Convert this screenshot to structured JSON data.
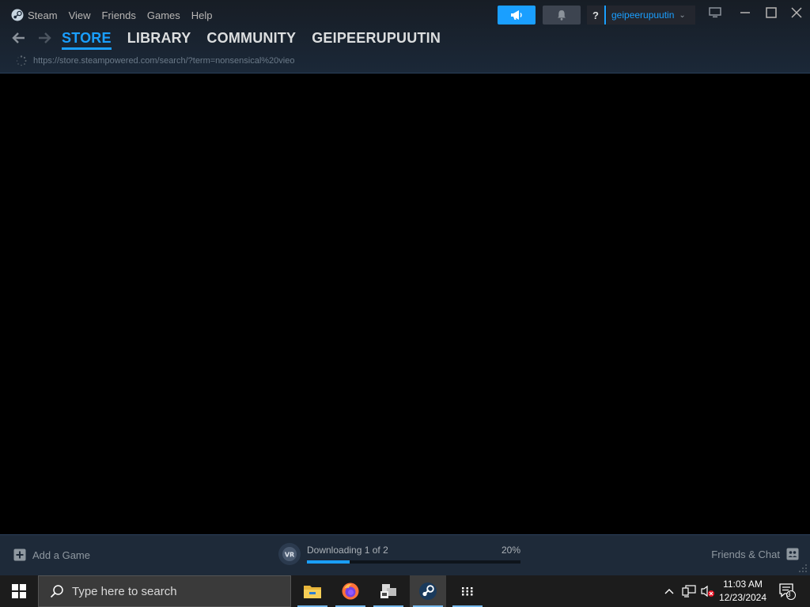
{
  "menu": {
    "items": [
      "Steam",
      "View",
      "Friends",
      "Games",
      "Help"
    ]
  },
  "nav": {
    "tabs": [
      "STORE",
      "LIBRARY",
      "COMMUNITY",
      "GEIPEERUPUUTIN"
    ],
    "active_tab": "STORE",
    "url": "https://store.steampowered.com/search/?term=nonsensical%20vieo"
  },
  "header": {
    "help_label": "?",
    "account_name": "geipeerupuutin",
    "accent_color": "#1a9fff"
  },
  "footer": {
    "add_game_label": "Add a Game",
    "download_status": "Downloading 1 of 2",
    "download_percent_label": "20%",
    "download_progress": 0.2,
    "friends_chat_label": "Friends & Chat"
  },
  "taskbar": {
    "search_placeholder": "Type here to search",
    "apps": [
      "file-explorer-icon",
      "firefox-icon",
      "vm-app-icon",
      "steam-icon",
      "app-grid-icon"
    ],
    "time": "11:03 AM",
    "date": "12/23/2024",
    "notification_count": "3"
  }
}
